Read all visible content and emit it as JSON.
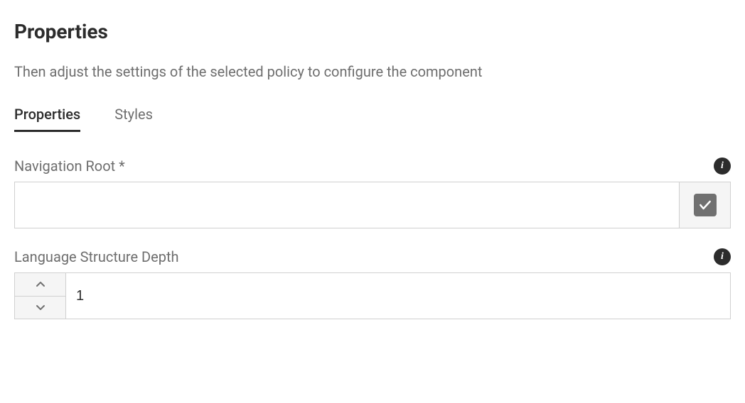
{
  "header": {
    "title": "Properties",
    "subtitle": "Then adjust the settings of the selected policy to configure the component"
  },
  "tabs": [
    {
      "label": "Properties",
      "active": true
    },
    {
      "label": "Styles",
      "active": false
    }
  ],
  "fields": {
    "navigation_root": {
      "label": "Navigation Root *",
      "value": ""
    },
    "lang_depth": {
      "label": "Language Structure Depth",
      "value": "1"
    }
  }
}
